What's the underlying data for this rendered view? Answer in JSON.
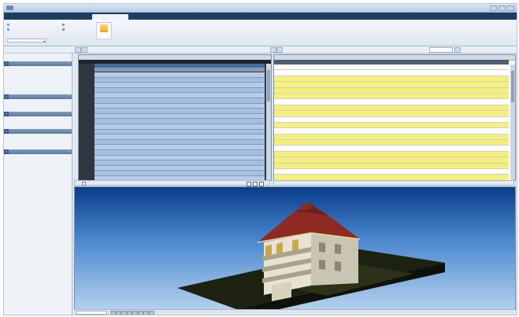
{
  "window": {
    "title": "",
    "controls": [
      "minimize",
      "maximize",
      "close"
    ]
  },
  "ribbon": {
    "tabs": [
      {
        "label": "",
        "active": false
      },
      {
        "label": "",
        "active": false
      },
      {
        "label": "",
        "active": false
      },
      {
        "label": "",
        "active": true
      }
    ],
    "items": [
      "",
      "",
      "",
      ""
    ],
    "big_button_label": "",
    "group_label": "",
    "select_value": ""
  },
  "sidebar": {
    "sections": [
      {
        "num": "1",
        "title": "",
        "items": [
          "",
          "",
          "",
          ""
        ]
      },
      {
        "num": "2",
        "title": "",
        "items": [
          ""
        ]
      },
      {
        "num": "3",
        "title": "",
        "items": [
          ""
        ]
      },
      {
        "num": "4",
        "title": "",
        "items": [
          "",
          ""
        ]
      },
      {
        "num": "5",
        "title": "",
        "items": [
          ""
        ]
      }
    ]
  },
  "left_grid": {
    "caption": "",
    "columns": [
      "",
      "",
      "",
      "",
      ""
    ],
    "rows": [
      {
        "c2": "",
        "c3": "",
        "c4": "",
        "c5": "",
        "state": "sel"
      },
      {
        "c2": "",
        "c3": "",
        "c4": "",
        "c5": "",
        "state": "alt"
      },
      {
        "c2": "",
        "c3": "",
        "c4": "",
        "c5": "",
        "state": "sel"
      },
      {
        "c2": "",
        "c3": "",
        "c4": "",
        "c5": "",
        "state": "alt"
      },
      {
        "c2": "",
        "c3": "",
        "c4": "",
        "c5": "",
        "state": "sel"
      },
      {
        "c2": "",
        "c3": "",
        "c4": "",
        "c5": "",
        "state": "alt"
      },
      {
        "c2": "",
        "c3": "",
        "c4": "",
        "c5": "",
        "state": "sel"
      },
      {
        "c2": "",
        "c3": "",
        "c4": "",
        "c5": "",
        "state": "alt"
      },
      {
        "c2": "",
        "c3": "",
        "c4": "",
        "c5": "",
        "state": "sel"
      },
      {
        "c2": "",
        "c3": "",
        "c4": "",
        "c5": "",
        "state": "alt"
      },
      {
        "c2": "",
        "c3": "",
        "c4": "",
        "c5": "",
        "state": "sel"
      },
      {
        "c2": "",
        "c3": "",
        "c4": "",
        "c5": "",
        "state": "alt"
      },
      {
        "c2": "",
        "c3": "",
        "c4": "",
        "c5": "",
        "state": "sel"
      },
      {
        "c2": "",
        "c3": "",
        "c4": "",
        "c5": "",
        "state": "alt"
      },
      {
        "c2": "",
        "c3": "",
        "c4": "",
        "c5": "",
        "state": "sel"
      },
      {
        "c2": "",
        "c3": "",
        "c4": "",
        "c5": "",
        "state": "alt"
      },
      {
        "c2": "",
        "c3": "",
        "c4": "",
        "c5": "",
        "state": "sel"
      },
      {
        "c2": "",
        "c3": "",
        "c4": "",
        "c5": "",
        "state": "alt"
      },
      {
        "c2": "",
        "c3": "",
        "c4": "",
        "c5": "",
        "state": "sel"
      },
      {
        "c2": "",
        "c3": "",
        "c4": "",
        "c5": "",
        "state": "alt"
      },
      {
        "c2": "",
        "c3": "",
        "c4": "",
        "c5": "",
        "state": "sel"
      },
      {
        "c2": "",
        "c3": "",
        "c4": "",
        "c5": "",
        "state": "alt"
      },
      {
        "c2": "",
        "c3": "",
        "c4": "",
        "c5": "",
        "state": "sel"
      },
      {
        "c2": "",
        "c3": "",
        "c4": "",
        "c5": "",
        "state": "alt"
      }
    ]
  },
  "right_grid": {
    "caption": "",
    "rows": [
      {
        "c1": "",
        "c2": "",
        "c3": "",
        "hl": false
      },
      {
        "c1": "",
        "c2": "",
        "c3": "",
        "hl": false
      },
      {
        "c1": "",
        "c2": "",
        "c3": "",
        "hl": true
      },
      {
        "c1": "",
        "c2": "",
        "c3": "",
        "hl": true
      },
      {
        "c1": "",
        "c2": "",
        "c3": "",
        "hl": true
      },
      {
        "c1": "",
        "c2": "",
        "c3": "",
        "hl": true
      },
      {
        "c1": "",
        "c2": "",
        "c3": "",
        "hl": false
      },
      {
        "c1": "",
        "c2": "",
        "c3": "",
        "hl": true
      },
      {
        "c1": "",
        "c2": "",
        "c3": "",
        "hl": true
      },
      {
        "c1": "",
        "c2": "",
        "c3": "",
        "hl": false
      },
      {
        "c1": "",
        "c2": "",
        "c3": "",
        "hl": true
      },
      {
        "c1": "",
        "c2": "",
        "c3": "",
        "hl": false
      },
      {
        "c1": "",
        "c2": "",
        "c3": "",
        "hl": true
      },
      {
        "c1": "",
        "c2": "",
        "c3": "",
        "hl": true
      },
      {
        "c1": "",
        "c2": "",
        "c3": "",
        "hl": false
      },
      {
        "c1": "",
        "c2": "",
        "c3": "",
        "hl": true
      },
      {
        "c1": "",
        "c2": "",
        "c3": "",
        "hl": true
      },
      {
        "c1": "",
        "c2": "",
        "c3": "",
        "hl": true
      },
      {
        "c1": "",
        "c2": "",
        "c3": "",
        "hl": false
      },
      {
        "c1": "",
        "c2": "",
        "c3": "",
        "hl": true
      },
      {
        "c1": "",
        "c2": "",
        "c3": "",
        "hl": true
      },
      {
        "c1": "",
        "c2": "",
        "c3": "",
        "hl": false
      }
    ]
  },
  "left_footer": {
    "label": "",
    "checkbox_label": ""
  },
  "right_footer": {
    "label": ""
  },
  "statusbar": {
    "field_value": ""
  },
  "colors": {
    "accent": "#1d3e63",
    "selection_blue": "#b7cbe6",
    "highlight_yellow": "#f6f07a",
    "roof": "#8f2a22"
  }
}
